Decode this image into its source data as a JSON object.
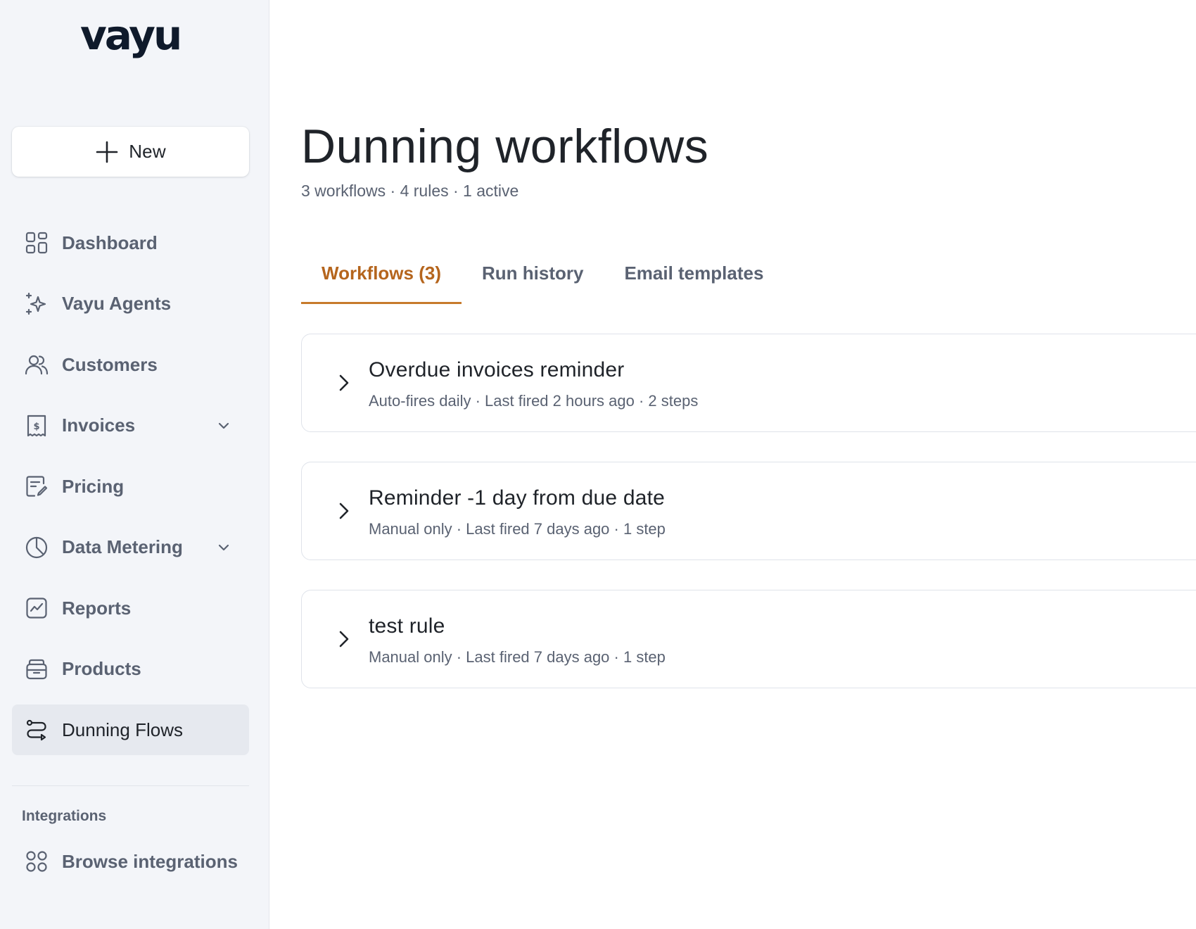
{
  "brand": {
    "logo_text": "vayu",
    "accent_color": "#c77a2b"
  },
  "sidebar": {
    "new_button_label": "New",
    "items": [
      {
        "label": "Dashboard",
        "icon": "dashboard-grid-icon",
        "has_submenu": false,
        "active": false
      },
      {
        "label": "Vayu Agents",
        "icon": "sparkle-icon",
        "has_submenu": false,
        "active": false
      },
      {
        "label": "Customers",
        "icon": "users-icon",
        "has_submenu": false,
        "active": false
      },
      {
        "label": "Invoices",
        "icon": "invoice-receipt-icon",
        "has_submenu": true,
        "active": false
      },
      {
        "label": "Pricing",
        "icon": "edit-document-icon",
        "has_submenu": false,
        "active": false
      },
      {
        "label": "Data Metering",
        "icon": "pie-chart-icon",
        "has_submenu": true,
        "active": false
      },
      {
        "label": "Reports",
        "icon": "line-chart-icon",
        "has_submenu": false,
        "active": false
      },
      {
        "label": "Products",
        "icon": "archive-box-icon",
        "has_submenu": false,
        "active": false
      },
      {
        "label": "Dunning Flows",
        "icon": "route-flow-icon",
        "has_submenu": false,
        "active": true
      }
    ],
    "integrations": {
      "section_label": "Integrations",
      "browse_label": "Browse integrations",
      "browse_icon": "circles-grid-icon"
    }
  },
  "main": {
    "title": "Dunning workflows",
    "subtitle": "3 workflows · 4 rules · 1 active",
    "tabs": [
      {
        "label": "Workflows (3)",
        "active": true
      },
      {
        "label": "Run history",
        "active": false
      },
      {
        "label": "Email templates",
        "active": false
      }
    ],
    "workflows": [
      {
        "title": "Overdue invoices reminder",
        "meta": "Auto-fires daily · Last fired 2 hours ago · 2 steps"
      },
      {
        "title": "Reminder -1 day from due date",
        "meta": "Manual only · Last fired 7 days ago · 1 step"
      },
      {
        "title": "test rule",
        "meta": "Manual only · Last fired 7 days ago · 1 step"
      }
    ]
  }
}
